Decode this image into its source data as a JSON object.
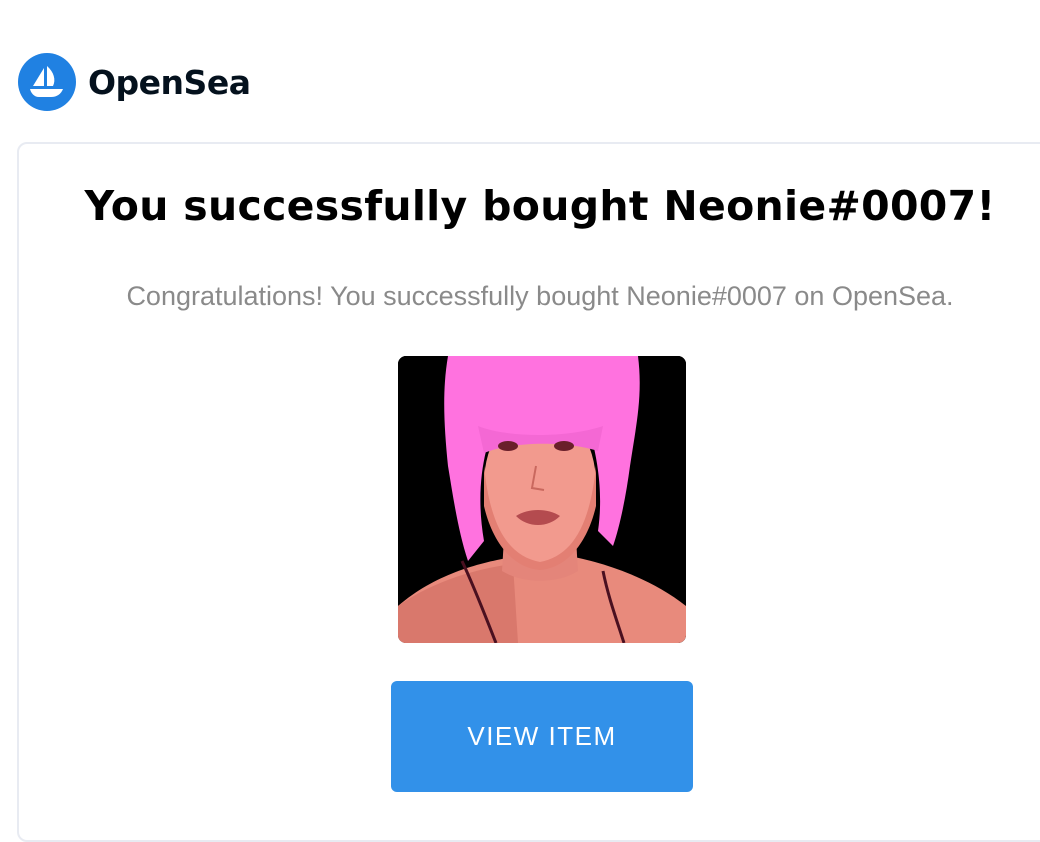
{
  "brand": {
    "name": "OpenSea",
    "logo_icon": "sailboat-icon",
    "logo_color": "#2081e2"
  },
  "message": {
    "title": "You successfully bought Neonie#0007!",
    "subtitle": "Congratulations! You successfully bought Neonie#0007 on OpenSea."
  },
  "item": {
    "image_icon": "nft-portrait-image"
  },
  "actions": {
    "view_item_label": "VIEW ITEM",
    "button_color": "#3291e9"
  }
}
